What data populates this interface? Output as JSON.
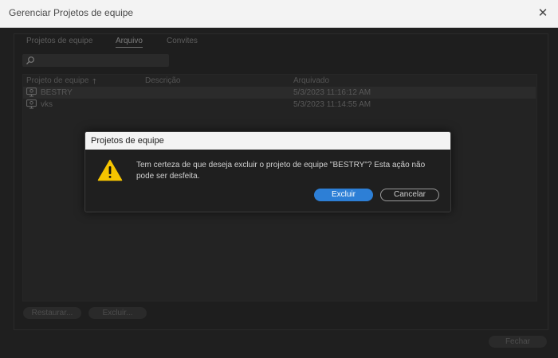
{
  "window": {
    "title": "Gerenciar Projetos de equipe",
    "close_icon": "close-icon"
  },
  "tabs": [
    {
      "label": "Projetos de equipe",
      "active": false
    },
    {
      "label": "Arquivo",
      "active": true
    },
    {
      "label": "Convites",
      "active": false
    }
  ],
  "search": {
    "placeholder": "",
    "icon": "search-icon"
  },
  "table": {
    "columns": [
      "Projeto de equipe",
      "Descrição",
      "Arquivado"
    ],
    "sort_icon": "sort-ascending-icon",
    "rows": [
      {
        "name": "BESTRY",
        "description": "",
        "archived": "5/3/2023 11:16:12 AM",
        "icon": "team-project-icon",
        "selected": true
      },
      {
        "name": "vks",
        "description": "",
        "archived": "5/3/2023 11:14:55 AM",
        "icon": "team-project-icon",
        "selected": false
      }
    ]
  },
  "buttons": {
    "restore_label": "Restaurar...",
    "delete_label": "Excluir...",
    "close_label": "Fechar"
  },
  "dialog": {
    "title": "Projetos de equipe",
    "icon": "warning-icon",
    "message": "Tem certeza de que deseja excluir o projeto de equipe \"BESTRY\"? Esta ação não pode ser desfeita.",
    "confirm_label": "Excluir",
    "cancel_label": "Cancelar"
  },
  "colors": {
    "accent": "#2d7fd6",
    "warning": "#f5c400",
    "background": "#1f1f1f"
  }
}
